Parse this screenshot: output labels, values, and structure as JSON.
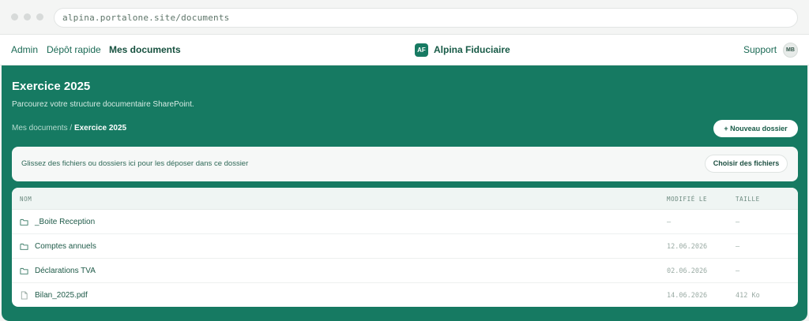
{
  "browser": {
    "url": "alpina.portalone.site/documents"
  },
  "nav": {
    "admin": "Admin",
    "depot": "Dépôt rapide",
    "documents": "Mes documents",
    "brand_logo": "AF",
    "brand_name": "Alpina Fiduciaire",
    "support": "Support",
    "avatar": "MB"
  },
  "page": {
    "title": "Exercice 2025",
    "subtitle": "Parcourez votre structure documentaire SharePoint.",
    "breadcrumb_parent": "Mes documents",
    "breadcrumb_sep": " / ",
    "breadcrumb_current": "Exercice 2025",
    "new_folder": "+ Nouveau dossier"
  },
  "dropzone": {
    "text": "Glissez des fichiers ou dossiers ici pour les déposer dans ce dossier",
    "button": "Choisir des fichiers"
  },
  "table": {
    "headers": {
      "name": "NOM",
      "modified": "MODIFIÉ LE",
      "size": "TAILLE"
    },
    "rows": [
      {
        "type": "folder",
        "icon": "folder-icon",
        "name": "_Boite Reception",
        "modified": "—",
        "size": "—"
      },
      {
        "type": "folder",
        "icon": "folder-icon",
        "name": "Comptes annuels",
        "modified": "12.06.2026",
        "size": "—"
      },
      {
        "type": "folder",
        "icon": "folder-icon",
        "name": "Déclarations TVA",
        "modified": "02.06.2026",
        "size": "—"
      },
      {
        "type": "file",
        "icon": "file-icon",
        "name": "Bilan_2025.pdf",
        "modified": "14.06.2026",
        "size": "412 Ko"
      }
    ]
  },
  "colors": {
    "accent": "#167a62",
    "text_dark": "#175a46"
  }
}
